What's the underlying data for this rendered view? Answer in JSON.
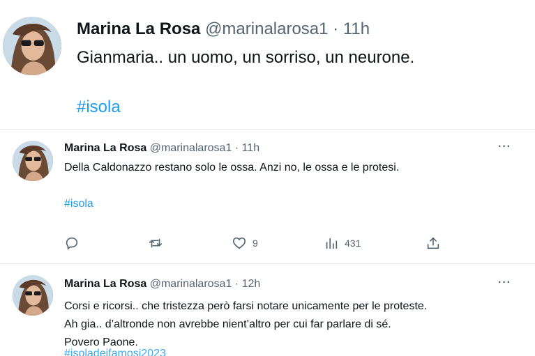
{
  "tweets": [
    {
      "name": "Marina La Rosa",
      "handle": "@marinalarosa1",
      "sep": "·",
      "time": "11h",
      "text": "Gianmaria.. un uomo, un sorriso, un neurone.",
      "hashtag": "#isola"
    },
    {
      "name": "Marina La Rosa",
      "handle": "@marinalarosa1",
      "sep": "·",
      "time": "11h",
      "text": "Della Caldonazzo restano solo le ossa. Anzi no, le ossa e le protesi.",
      "hashtag": "#isola",
      "more": "···",
      "actions": {
        "reply": "",
        "retweet": "",
        "likes": "9",
        "views": "431",
        "share": ""
      }
    },
    {
      "name": "Marina La Rosa",
      "handle": "@marinalarosa1",
      "sep": "·",
      "time": "12h",
      "lines": [
        "Corsi e ricorsi.. che tristezza però farsi notare unicamente per le proteste.",
        "Ah gia.. d’altronde non avrebbe nient’altro per cui far parlare di sé.",
        "Povero Paone."
      ],
      "hashtag": "#isoladeifamosi2023",
      "more": "···"
    }
  ],
  "colors": {
    "link": "#1d9bf0",
    "muted": "#536471",
    "text": "#0f1419"
  }
}
